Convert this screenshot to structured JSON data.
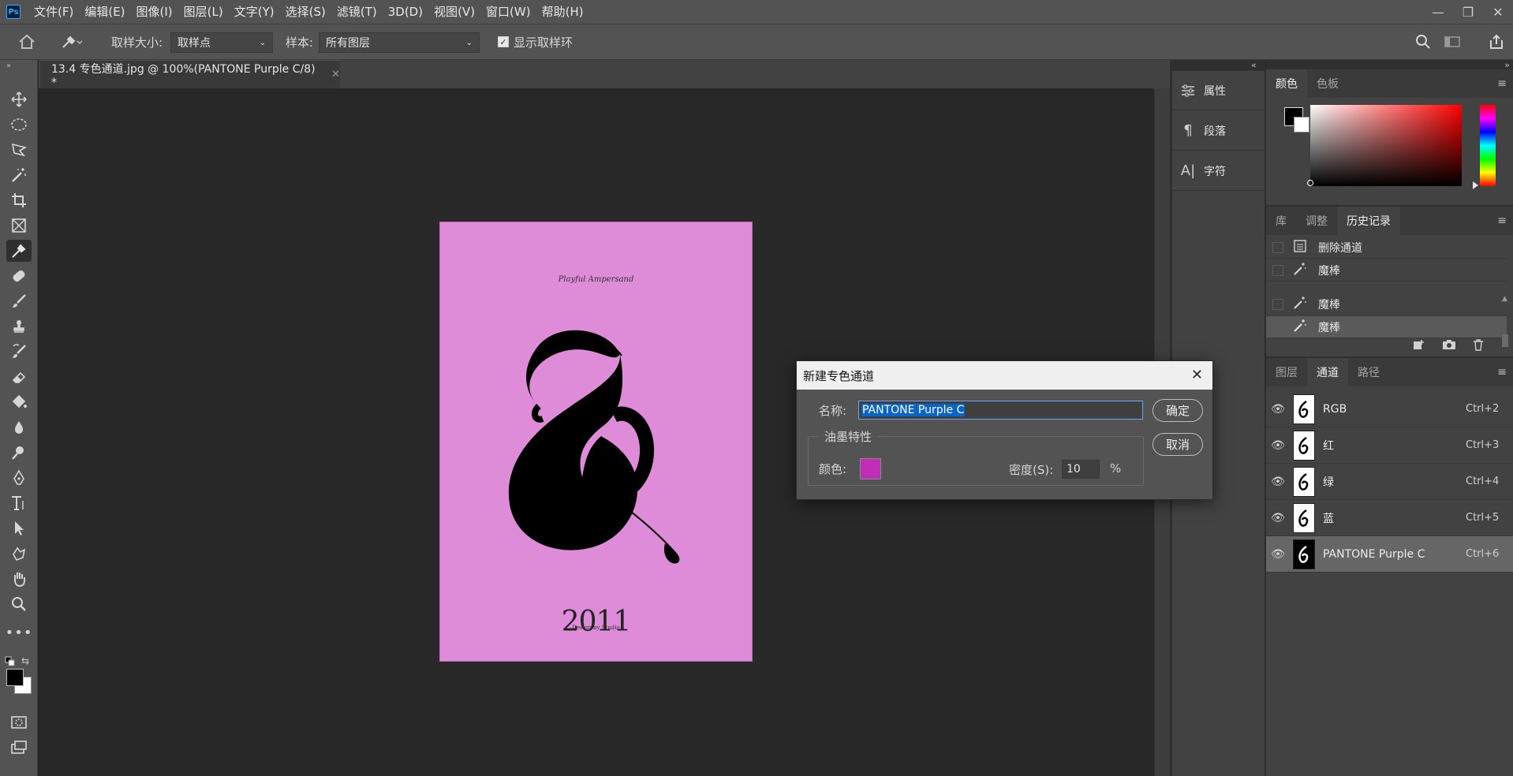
{
  "app": {
    "logo": "Ps"
  },
  "menu": [
    "文件(F)",
    "编辑(E)",
    "图像(I)",
    "图层(L)",
    "文字(Y)",
    "选择(S)",
    "滤镜(T)",
    "3D(D)",
    "视图(V)",
    "窗口(W)",
    "帮助(H)"
  ],
  "options": {
    "sample_size_label": "取样大小:",
    "sample_size_value": "取样点",
    "sample_label": "样本:",
    "sample_value": "所有图层",
    "show_ring_label": "显示取样环"
  },
  "document": {
    "tab_title": "13.4 专色通道.jpg @ 100%(PANTONE Purple C/8) *",
    "artwork_title": "Playful Ampersand",
    "artwork_year": "2011",
    "artwork_sub": "Design by Studio"
  },
  "mini_panels": [
    {
      "label": "属性",
      "icon": "properties-icon"
    },
    {
      "label": "段落",
      "icon": "paragraph-icon"
    },
    {
      "label": "字符",
      "icon": "character-icon"
    }
  ],
  "color_panel": {
    "tabs": [
      "颜色",
      "色板"
    ],
    "active": 0,
    "foreground": "#000000",
    "background": "#ffffff"
  },
  "history_panel": {
    "tabs": [
      "库",
      "调整",
      "历史记录"
    ],
    "active": 2,
    "items": [
      {
        "label": "删除通道",
        "icon": "document-icon"
      },
      {
        "label": "魔棒",
        "icon": "magic-wand-icon"
      },
      {
        "label": "魔棒",
        "icon": "magic-wand-icon"
      },
      {
        "label": "魔棒",
        "icon": "magic-wand-icon"
      }
    ]
  },
  "channels_panel": {
    "tabs": [
      "图层",
      "通道",
      "路径"
    ],
    "active": 1,
    "items": [
      {
        "name": "RGB",
        "shortcut": "Ctrl+2"
      },
      {
        "name": "红",
        "shortcut": "Ctrl+3"
      },
      {
        "name": "绿",
        "shortcut": "Ctrl+4"
      },
      {
        "name": "蓝",
        "shortcut": "Ctrl+5"
      },
      {
        "name": "PANTONE Purple C",
        "shortcut": "Ctrl+6"
      }
    ]
  },
  "dialog": {
    "title": "新建专色通道",
    "name_label": "名称:",
    "name_value": "PANTONE Purple C",
    "ink_group": "油墨特性",
    "color_label": "颜色:",
    "ink_color": "#c02eb8",
    "density_label": "密度(S):",
    "density_value": "10",
    "percent": "%",
    "ok": "确定",
    "cancel": "取消"
  },
  "colors": {
    "artwork_bg": "#de8bd8",
    "accent": "#0a64c8"
  }
}
